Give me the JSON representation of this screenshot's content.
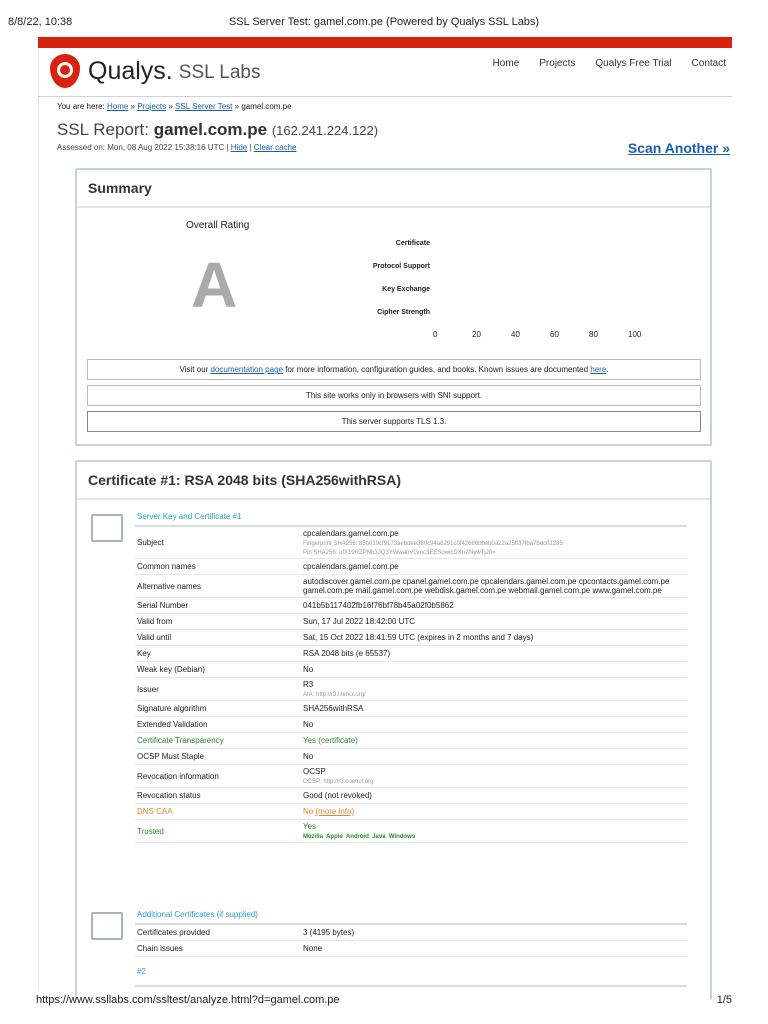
{
  "print": {
    "datetime": "8/8/22, 10:38",
    "title": "SSL Server Test: gamel.com.pe (Powered by Qualys SSL Labs)",
    "url": "https://www.ssllabs.com/ssltest/analyze.html?d=gamel.com.pe",
    "page": "1/5"
  },
  "brand": {
    "name": "Qualys.",
    "product": "SSL Labs",
    "color": "#d9210f"
  },
  "nav": [
    "Home",
    "Projects",
    "Qualys Free Trial",
    "Contact"
  ],
  "breadcrumb": {
    "prefix": "You are here:",
    "items": [
      "Home",
      "Projects",
      "SSL Server Test"
    ],
    "current": "gamel.com.pe"
  },
  "report": {
    "label": "SSL Report:",
    "host": "gamel.com.pe",
    "ip": "(162.241.224.122)",
    "assessed_label": "Assessed on:",
    "assessed": "Mon, 08 Aug 2022 15:38:16 UTC |",
    "hide": "Hide",
    "clear": "Clear cache",
    "scan_another": "Scan Another »"
  },
  "summary": {
    "title": "Summary",
    "overall": "Overall Rating",
    "grade": "A",
    "categories": [
      "Certificate",
      "Protocol Support",
      "Key Exchange",
      "Cipher Strength"
    ],
    "ticks": [
      "0",
      "20",
      "40",
      "60",
      "80",
      "100"
    ],
    "notice1": {
      "pre": "Visit our",
      "link": "documentation page",
      "mid": "for more information, configuration guides, and books. Known issues are documented",
      "link2": "here",
      "post": "."
    },
    "notice2": "This site works only in browsers with SNI support.",
    "notice3": "This server supports TLS 1.3."
  },
  "cert": {
    "title": "Certificate #1: RSA 2048 bits (SHA256withRSA)",
    "section": "Server Key and Certificate #1",
    "subject": {
      "k": "Subject",
      "v": "cpcalendars.gamel.com.pe",
      "fp": "Fingerprint SHA256: 85b019cf9173aebdee380c94a6291c0f42686bbeb0a22a25ff37fba7bdc01285",
      "pin": "Pin SHA256: ufX19RZPNb3JQ3YWwanVGmc3EESowicDXn7htywTjJ0="
    },
    "rows": [
      {
        "k": "Common names",
        "v": "cpcalendars.gamel.com.pe"
      },
      {
        "k": "Alternative names",
        "v": "autodiscover.gamel.com.pe cpanel.gamel.com.pe cpcalendars.gamel.com.pe cpcontacts.gamel.com.pe gamel.com.pe mail.gamel.com.pe webdisk.gamel.com.pe webmail.gamel.com.pe www.gamel.com.pe"
      },
      {
        "k": "Serial Number",
        "v": "041b5b117402fb16f76bf78b45a02f0b5862"
      },
      {
        "k": "Valid from",
        "v": "Sun, 17 Jul 2022 18:42:00 UTC"
      },
      {
        "k": "Valid until",
        "v": "Sat, 15 Oct 2022 18:41:59 UTC (expires in 2 months and 7 days)"
      },
      {
        "k": "Key",
        "v": "RSA 2048 bits (e 65537)"
      },
      {
        "k": "Weak key (Debian)",
        "v": "No"
      }
    ],
    "issuer": {
      "k": "Issuer",
      "v": "R3",
      "sub": "AIA: http://r3.i.lencr.org/"
    },
    "rows2": [
      {
        "k": "Signature algorithm",
        "v": "SHA256withRSA"
      },
      {
        "k": "Extended Validation",
        "v": "No"
      },
      {
        "k": "Certificate Transparency",
        "v": "Yes (certificate)"
      },
      {
        "k": "OCSP Must Staple",
        "v": "No"
      }
    ],
    "revinfo": {
      "k": "Revocation information",
      "v": "OCSP",
      "sub": "OCSP: http://r3.o.lencr.org"
    },
    "revstatus": {
      "k": "Revocation status",
      "v": "Good (not revoked)"
    },
    "caa": {
      "k": "DNS CAA",
      "v": "No",
      "link": "(more info)"
    },
    "trusted": {
      "k": "Trusted",
      "v": "Yes",
      "stores": "Mozilla  Apple  Android  Java  Windows"
    },
    "additional": {
      "title": "Additional Certificates (if supplied)",
      "rows": [
        {
          "k": "Certificates provided",
          "v": "3 (4195 bytes)"
        },
        {
          "k": "Chain issues",
          "v": "None"
        }
      ],
      "next": "#2"
    }
  }
}
